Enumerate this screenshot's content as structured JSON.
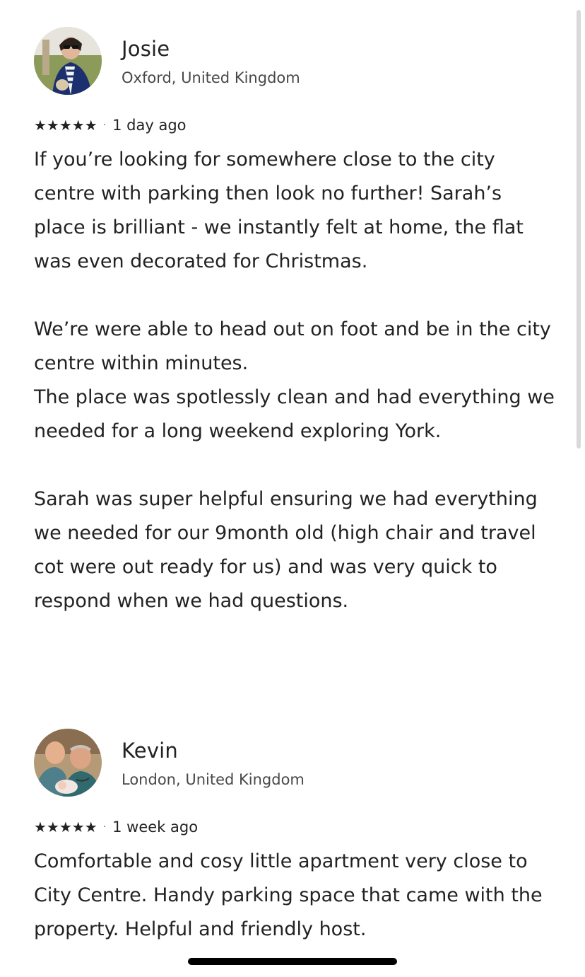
{
  "reviews": [
    {
      "name": "Josie",
      "location": "Oxford, United Kingdom",
      "stars": "★★★★★",
      "rating": 5,
      "separator": "·",
      "date": "1 day ago",
      "text": "If you’re looking for somewhere close to the city centre with parking then look no further! Sarah’s place is brilliant - we instantly felt at home, the flat was even decorated for Christmas.\n\nWe’re were able to head out on foot and be in the city centre within minutes.\nThe place was spotlessly clean and had everything we needed for a long weekend exploring York.\n\nSarah was super helpful ensuring we had everything we needed for our 9month old (high chair and travel cot were out ready for us) and was very quick to respond when we had questions."
    },
    {
      "name": "Kevin",
      "location": "London, United Kingdom",
      "stars": "★★★★★",
      "rating": 5,
      "separator": "·",
      "date": "1 week ago",
      "text": "Comfortable and cosy little apartment very close to City Centre. Handy parking space that came with the property. Helpful and friendly host."
    }
  ],
  "colors": {
    "text": "#222222",
    "secondary_text": "#484848",
    "background": "#ffffff"
  }
}
